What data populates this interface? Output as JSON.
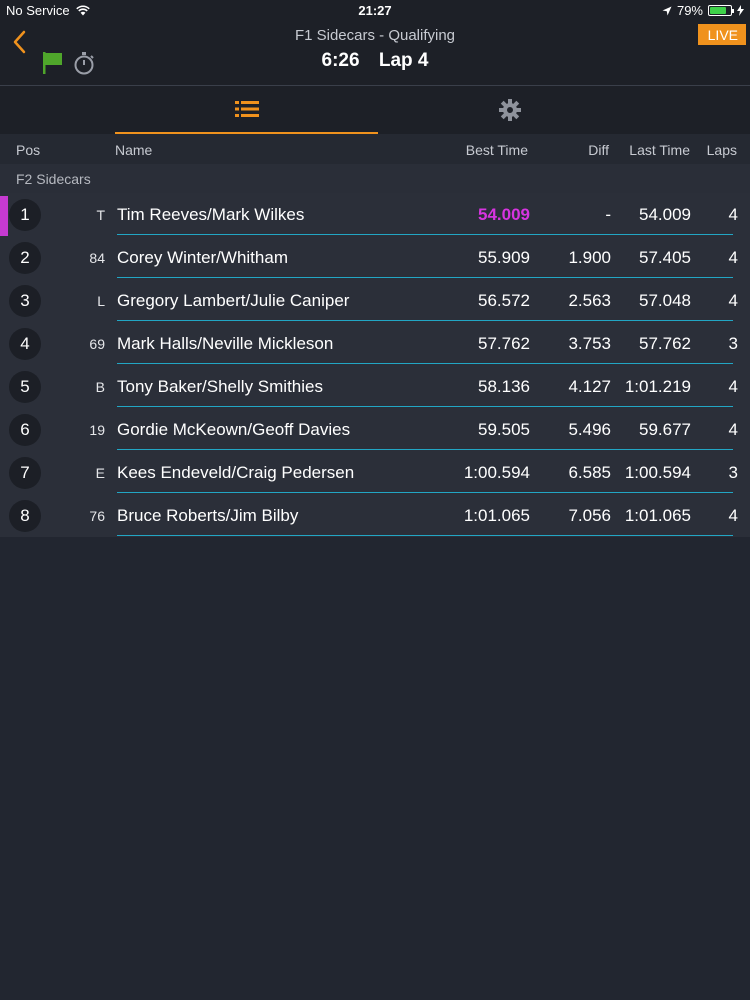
{
  "status": {
    "carrier": "No Service",
    "time": "21:27",
    "battery_pct": "79%",
    "battery_level": 0.79
  },
  "header": {
    "session": "F1 Sidecars - Qualifying",
    "clock": "6:26",
    "lap": "Lap 4",
    "live_label": "LIVE"
  },
  "tabs": [
    {
      "icon": "list-icon",
      "active": true
    },
    {
      "icon": "gear-icon",
      "active": false
    }
  ],
  "columns": {
    "pos": "Pos",
    "name": "Name",
    "best": "Best Time",
    "diff": "Diff",
    "last": "Last Time",
    "laps": "Laps"
  },
  "group": "F2 Sidecars",
  "rows": [
    {
      "pos": "1",
      "num": "T",
      "name": "Tim Reeves/Mark Wilkes",
      "best": "54.009",
      "diff": "-",
      "last": "54.009",
      "laps": "4"
    },
    {
      "pos": "2",
      "num": "84",
      "name": "Corey Winter/Whitham",
      "best": "55.909",
      "diff": "1.900",
      "last": "57.405",
      "laps": "4"
    },
    {
      "pos": "3",
      "num": "L",
      "name": "Gregory Lambert/Julie Caniper",
      "best": "56.572",
      "diff": "2.563",
      "last": "57.048",
      "laps": "4"
    },
    {
      "pos": "4",
      "num": "69",
      "name": "Mark Halls/Neville Mickleson",
      "best": "57.762",
      "diff": "3.753",
      "last": "57.762",
      "laps": "3"
    },
    {
      "pos": "5",
      "num": "B",
      "name": "Tony Baker/Shelly Smithies",
      "best": "58.136",
      "diff": "4.127",
      "last": "1:01.219",
      "laps": "4"
    },
    {
      "pos": "6",
      "num": "19",
      "name": "Gordie McKeown/Geoff Davies",
      "best": "59.505",
      "diff": "5.496",
      "last": "59.677",
      "laps": "4"
    },
    {
      "pos": "7",
      "num": "E",
      "name": "Kees Endeveld/Craig Pedersen",
      "best": "1:00.594",
      "diff": "6.585",
      "last": "1:00.594",
      "laps": "3"
    },
    {
      "pos": "8",
      "num": "76",
      "name": "Bruce Roberts/Jim Bilby",
      "best": "1:01.065",
      "diff": "7.056",
      "last": "1:01.065",
      "laps": "4"
    }
  ],
  "colors": {
    "accent": "#f0921d",
    "fastest": "#d734e0",
    "underline": "#22a6c4",
    "flag": "#4fa62b"
  }
}
